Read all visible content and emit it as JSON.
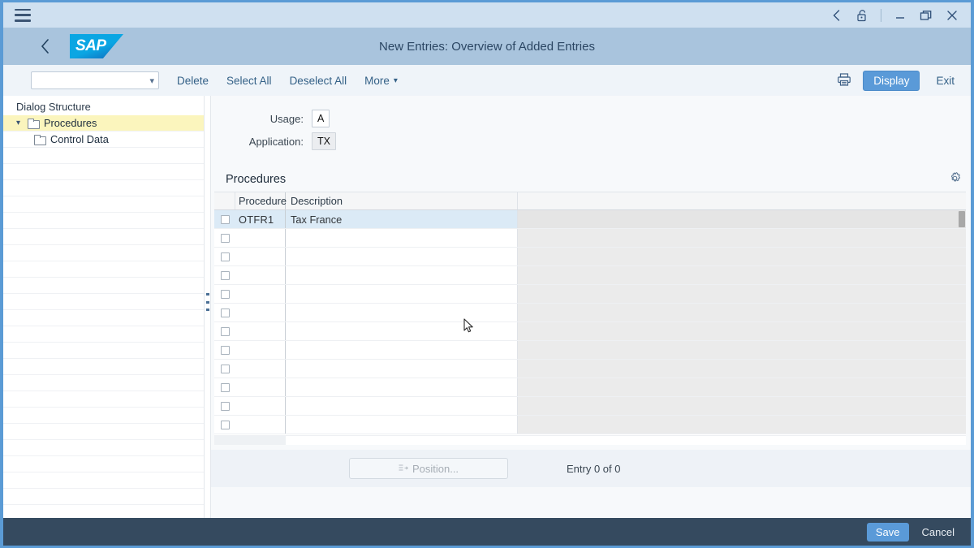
{
  "window": {
    "menu_icon": "hamburger-icon",
    "controls": [
      "back-chevron-icon",
      "unlock-icon",
      "minimize-icon",
      "restore-icon",
      "close-icon"
    ]
  },
  "shell": {
    "back_label": "‹",
    "logo_text": "SAP",
    "title": "New Entries: Overview of Added Entries"
  },
  "toolbar": {
    "combo_value": "",
    "combo_placeholder": "",
    "delete_label": "Delete",
    "select_all_label": "Select All",
    "deselect_all_label": "Deselect All",
    "more_label": "More",
    "print_icon": "printer-icon",
    "display_label": "Display",
    "exit_label": "Exit"
  },
  "sidebar": {
    "title": "Dialog Structure",
    "items": [
      {
        "label": "Procedures",
        "selected": true,
        "indent": false
      },
      {
        "label": "Control Data",
        "selected": false,
        "indent": true
      }
    ]
  },
  "form": {
    "usage_label": "Usage:",
    "usage_value": "A",
    "application_label": "Application:",
    "application_value": "TX"
  },
  "section": {
    "title": "Procedures",
    "settings_icon": "gear-icon"
  },
  "table": {
    "columns": [
      "Procedure",
      "Description"
    ],
    "rows": [
      {
        "procedure": "OTFR1",
        "description": "Tax France",
        "selected": true
      },
      {
        "procedure": "",
        "description": "",
        "selected": false
      },
      {
        "procedure": "",
        "description": "",
        "selected": false
      },
      {
        "procedure": "",
        "description": "",
        "selected": false
      },
      {
        "procedure": "",
        "description": "",
        "selected": false
      },
      {
        "procedure": "",
        "description": "",
        "selected": false
      },
      {
        "procedure": "",
        "description": "",
        "selected": false
      },
      {
        "procedure": "",
        "description": "",
        "selected": false
      },
      {
        "procedure": "",
        "description": "",
        "selected": false
      },
      {
        "procedure": "",
        "description": "",
        "selected": false
      },
      {
        "procedure": "",
        "description": "",
        "selected": false
      },
      {
        "procedure": "",
        "description": "",
        "selected": false
      }
    ]
  },
  "content_footer": {
    "position_label": "Position...",
    "entry_count": "Entry 0 of 0"
  },
  "footer": {
    "save_label": "Save",
    "cancel_label": "Cancel"
  },
  "colors": {
    "accent": "#5a9ad8",
    "shell": "#a9c4dd",
    "footer": "#354a5f",
    "selected_row": "#dbeaf6",
    "tree_selected": "#fbf5bd"
  }
}
